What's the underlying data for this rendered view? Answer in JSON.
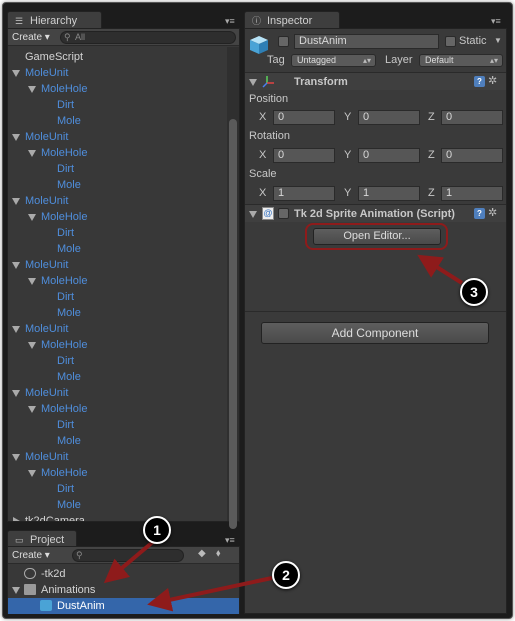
{
  "hierarchy": {
    "tab_label": "Hierarchy",
    "create_label": "Create",
    "search_placeholder": "All",
    "items": [
      {
        "label": "GameScript",
        "color": "white",
        "indent": 0,
        "expanded": null
      },
      {
        "label": "MoleUnit",
        "color": "blue",
        "indent": 0,
        "expanded": true
      },
      {
        "label": "MoleHole",
        "color": "blue",
        "indent": 1,
        "expanded": true
      },
      {
        "label": "Dirt",
        "color": "blue",
        "indent": 2,
        "expanded": null
      },
      {
        "label": "Mole",
        "color": "blue",
        "indent": 2,
        "expanded": null
      },
      {
        "label": "MoleUnit",
        "color": "blue",
        "indent": 0,
        "expanded": true
      },
      {
        "label": "MoleHole",
        "color": "blue",
        "indent": 1,
        "expanded": true
      },
      {
        "label": "Dirt",
        "color": "blue",
        "indent": 2,
        "expanded": null
      },
      {
        "label": "Mole",
        "color": "blue",
        "indent": 2,
        "expanded": null
      },
      {
        "label": "MoleUnit",
        "color": "blue",
        "indent": 0,
        "expanded": true
      },
      {
        "label": "MoleHole",
        "color": "blue",
        "indent": 1,
        "expanded": true
      },
      {
        "label": "Dirt",
        "color": "blue",
        "indent": 2,
        "expanded": null
      },
      {
        "label": "Mole",
        "color": "blue",
        "indent": 2,
        "expanded": null
      },
      {
        "label": "MoleUnit",
        "color": "blue",
        "indent": 0,
        "expanded": true
      },
      {
        "label": "MoleHole",
        "color": "blue",
        "indent": 1,
        "expanded": true
      },
      {
        "label": "Dirt",
        "color": "blue",
        "indent": 2,
        "expanded": null
      },
      {
        "label": "Mole",
        "color": "blue",
        "indent": 2,
        "expanded": null
      },
      {
        "label": "MoleUnit",
        "color": "blue",
        "indent": 0,
        "expanded": true
      },
      {
        "label": "MoleHole",
        "color": "blue",
        "indent": 1,
        "expanded": true
      },
      {
        "label": "Dirt",
        "color": "blue",
        "indent": 2,
        "expanded": null
      },
      {
        "label": "Mole",
        "color": "blue",
        "indent": 2,
        "expanded": null
      },
      {
        "label": "MoleUnit",
        "color": "blue",
        "indent": 0,
        "expanded": true
      },
      {
        "label": "MoleHole",
        "color": "blue",
        "indent": 1,
        "expanded": true
      },
      {
        "label": "Dirt",
        "color": "blue",
        "indent": 2,
        "expanded": null
      },
      {
        "label": "Mole",
        "color": "blue",
        "indent": 2,
        "expanded": null
      },
      {
        "label": "MoleUnit",
        "color": "blue",
        "indent": 0,
        "expanded": true
      },
      {
        "label": "MoleHole",
        "color": "blue",
        "indent": 1,
        "expanded": true
      },
      {
        "label": "Dirt",
        "color": "blue",
        "indent": 2,
        "expanded": null
      },
      {
        "label": "Mole",
        "color": "blue",
        "indent": 2,
        "expanded": null
      },
      {
        "label": "tk2dCamera",
        "color": "white",
        "indent": 0,
        "expanded": false
      }
    ]
  },
  "project": {
    "tab_label": "Project",
    "create_label": "Create",
    "items": [
      {
        "label": "-tk2d",
        "icon": "prefab-icon",
        "indent": 0,
        "expanded": null
      },
      {
        "label": "Animations",
        "icon": "folder-icon",
        "indent": 0,
        "expanded": true
      },
      {
        "label": "DustAnim",
        "icon": "cube-icon",
        "indent": 1,
        "expanded": null,
        "selected": true
      }
    ]
  },
  "inspector": {
    "tab_label": "Inspector",
    "object_name": "DustAnim",
    "static_label": "Static",
    "tag_label": "Tag",
    "tag_value": "Untagged",
    "layer_label": "Layer",
    "layer_value": "Default",
    "transform": {
      "title": "Transform",
      "position_label": "Position",
      "rotation_label": "Rotation",
      "scale_label": "Scale",
      "axis_x": "X",
      "axis_y": "Y",
      "axis_z": "Z",
      "position": [
        "0",
        "0",
        "0"
      ],
      "rotation": [
        "0",
        "0",
        "0"
      ],
      "scale": [
        "1",
        "1",
        "1"
      ]
    },
    "sprite_anim": {
      "title": "Tk 2d Sprite Animation (Script)",
      "open_editor_label": "Open Editor..."
    },
    "add_component_label": "Add Component"
  },
  "callouts": [
    "1",
    "2",
    "3"
  ],
  "colors": {
    "arrow": "#8e1b1b",
    "link_blue": "#4f8edc",
    "selection": "#3466aa"
  }
}
